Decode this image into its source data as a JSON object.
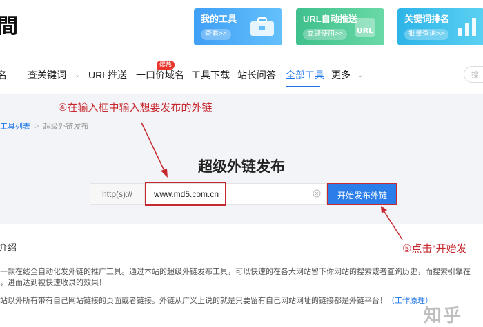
{
  "header": {
    "logo_fragment": "間",
    "promos": [
      {
        "title": "我的工具",
        "button": "查看>>",
        "icon": "toolbox-icon"
      },
      {
        "title": "URL自动推送",
        "button": "立即使用>>",
        "icon": "url-icon",
        "icon_text": "URL"
      },
      {
        "title": "关键词排名",
        "button": "批量查询>>",
        "icon": "bar-chart-icon"
      }
    ]
  },
  "nav": {
    "items": [
      "名",
      "查关键词",
      "URL推送",
      "一口价域名",
      "工具下载",
      "站长问答",
      "全部工具",
      "更多"
    ],
    "active": "全部工具",
    "hot_badge": "爆热",
    "search_placeholder": "搜"
  },
  "breadcrumb": {
    "parent": "工具列表",
    "current": "超级外链发布"
  },
  "tool": {
    "title": "超级外链发布",
    "protocol": "http(s)://",
    "url_value": "www.md5.com.cn",
    "publish_label": "开始发布外链"
  },
  "annotations": {
    "step4": "④在输入框中输入想要发布的外链",
    "step5": "⑤点击“开始发"
  },
  "intro": {
    "heading": "介绍",
    "p1": "一款在线全自动化发外链的推广工具。通过本站的超级外链发布工具，可以快速的在各大网站留下你网站的搜索或者查询历史，而搜索引擎在",
    "p2": "，进而达到被快速收录的效果！",
    "p3": "站以外所有带有自己网站链接的页面或者链接。外链从广义上说的就是只要留有自己网站网址的链接都是外链平台！",
    "p3_link": "（工作原理）"
  },
  "watermark": "知乎",
  "colors": {
    "accent": "#1a73e8",
    "annotation": "#c6282f",
    "button": "#2b7de9"
  }
}
